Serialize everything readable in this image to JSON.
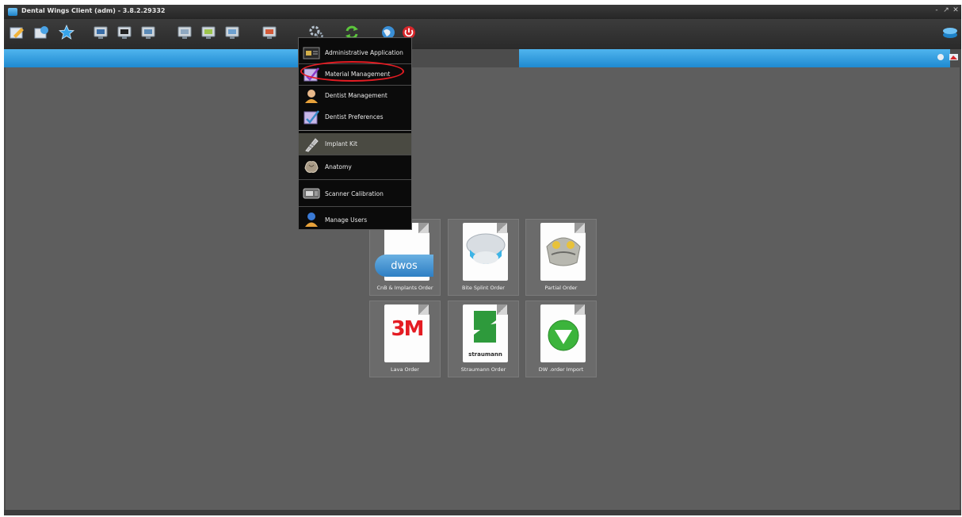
{
  "window": {
    "title": "Dental Wings Client (adm) - 3.8.2.29332",
    "controls": [
      "-",
      "↗",
      "✕"
    ]
  },
  "toolbar": {
    "icons": [
      "edit-icon",
      "scan-icon",
      "star-icon",
      "monitor-icon",
      "monitor-icon",
      "monitor-icon",
      "monitor-icon",
      "monitor-icon",
      "monitor-icon",
      "monitor-icon",
      "settings-icon",
      "refresh-icon",
      "globe-icon",
      "power-icon"
    ]
  },
  "menu": {
    "items": [
      {
        "label": "Administrative Application",
        "icon": "admin-icon"
      },
      {
        "label": "Material Management",
        "icon": "material-icon"
      },
      {
        "label": "Dentist Management",
        "icon": "dentist-icon"
      },
      {
        "label": "Dentist Preferences",
        "icon": "preferences-icon"
      },
      {
        "label": "Implant Kit",
        "icon": "implant-icon"
      },
      {
        "label": "Anatomy",
        "icon": "anatomy-icon"
      },
      {
        "label": "Scanner Calibration",
        "icon": "scanner-icon"
      },
      {
        "label": "Manage Users",
        "icon": "users-icon"
      }
    ]
  },
  "tiles": [
    {
      "label": "CnB & Implants Order",
      "logo_text": "dwos"
    },
    {
      "label": "Bite Splint Order"
    },
    {
      "label": "Partial Order"
    },
    {
      "label": "Lava Order",
      "logo_text": "3M"
    },
    {
      "label": "Straumann Order",
      "logo_text": "straumann"
    },
    {
      "label": "DW .order Import"
    }
  ],
  "colors": {
    "ribbon": "#2a94d6",
    "highlight": "#e41c23",
    "background": "#5e5e5e"
  }
}
